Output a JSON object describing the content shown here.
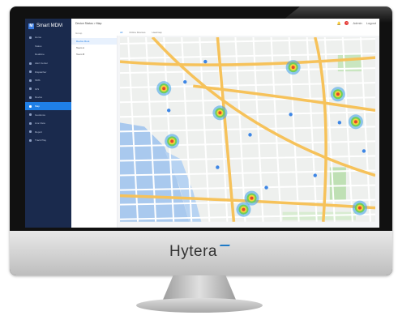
{
  "app": {
    "title": "Smart MDM"
  },
  "sidebar": {
    "items": [
      {
        "label": "Home",
        "sub": false,
        "active": false
      },
      {
        "label": "Status",
        "sub": true,
        "active": false
      },
      {
        "label": "Realtime",
        "sub": true,
        "active": false
      },
      {
        "label": "Alert Center",
        "sub": false,
        "active": false
      },
      {
        "label": "Dispatcher",
        "sub": false,
        "active": false
      },
      {
        "label": "SMS",
        "sub": false,
        "active": false
      },
      {
        "label": "GIS",
        "sub": false,
        "active": false
      },
      {
        "label": "Device",
        "sub": false,
        "active": false
      },
      {
        "label": "Map",
        "sub": false,
        "active": true
      },
      {
        "label": "Geofence",
        "sub": false,
        "active": false
      },
      {
        "label": "Live View",
        "sub": false,
        "active": false
      },
      {
        "label": "Report",
        "sub": false,
        "active": false
      },
      {
        "label": "Track Play",
        "sub": false,
        "active": false
      }
    ]
  },
  "topbar": {
    "breadcrumb": "Device Status > Map",
    "notif_count": "1",
    "user": "Admin",
    "logout": "Logout"
  },
  "panel": {
    "title": "Group",
    "tree": [
      "Device Root",
      "Team A",
      "Team B"
    ]
  },
  "map_tabs": [
    "All",
    "Online Devices",
    "Heatmap"
  ],
  "brand": {
    "name": "Hytera"
  }
}
